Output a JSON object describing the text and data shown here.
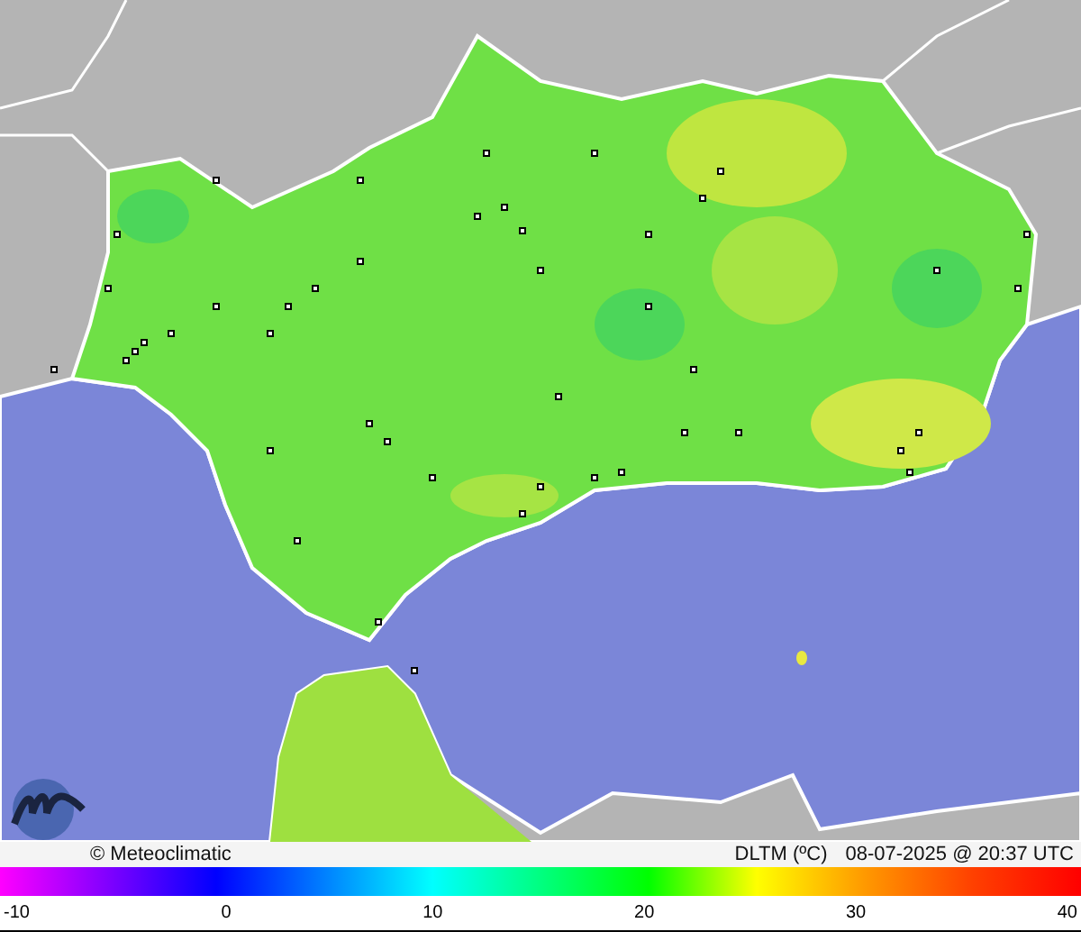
{
  "map": {
    "attribution": "© Meteoclimatic",
    "variable": "DLTM (ºC)",
    "timestamp": "08-07-2025 @ 20:37 UTC"
  },
  "scale": {
    "ticks": [
      "-10",
      "0",
      "10",
      "20",
      "30",
      "40"
    ]
  }
}
